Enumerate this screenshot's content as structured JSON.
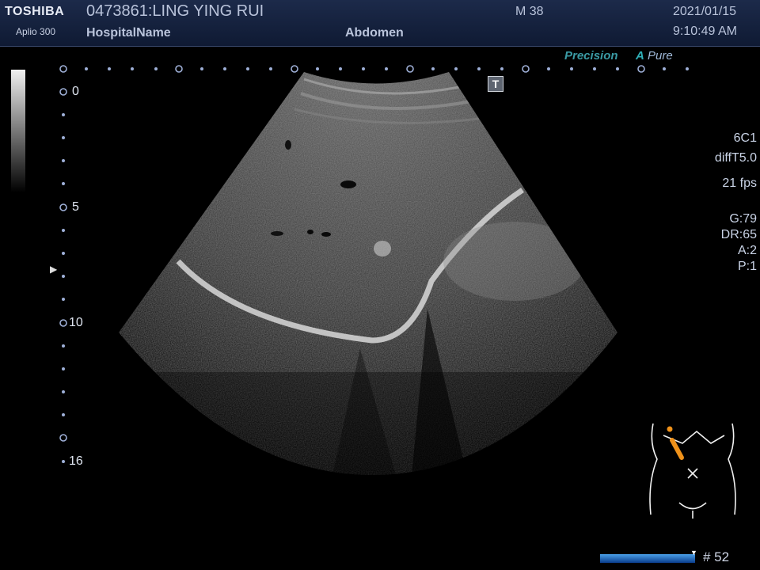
{
  "header": {
    "brand": "TOSHIBA",
    "model": "Aplio 300",
    "patient": "0473861:LING YING RUI",
    "hospital": "HospitalName",
    "exam": "Abdomen",
    "mi": "M 38",
    "date": "2021/01/15",
    "time": "9:10:49 AM"
  },
  "modes": {
    "precision": "Precision",
    "apure_a": "A",
    "apure_rest": "Pure",
    "t_marker": "T"
  },
  "depth_scale": {
    "labels": [
      "0",
      "5",
      "10",
      "16"
    ]
  },
  "params": {
    "probe": "6C1",
    "preset": "diffT5.0",
    "fps": "21 fps",
    "gain": "G:79",
    "dr": "DR:65",
    "a": "A:2",
    "p": "P:1"
  },
  "frame": {
    "number": "# 52"
  }
}
